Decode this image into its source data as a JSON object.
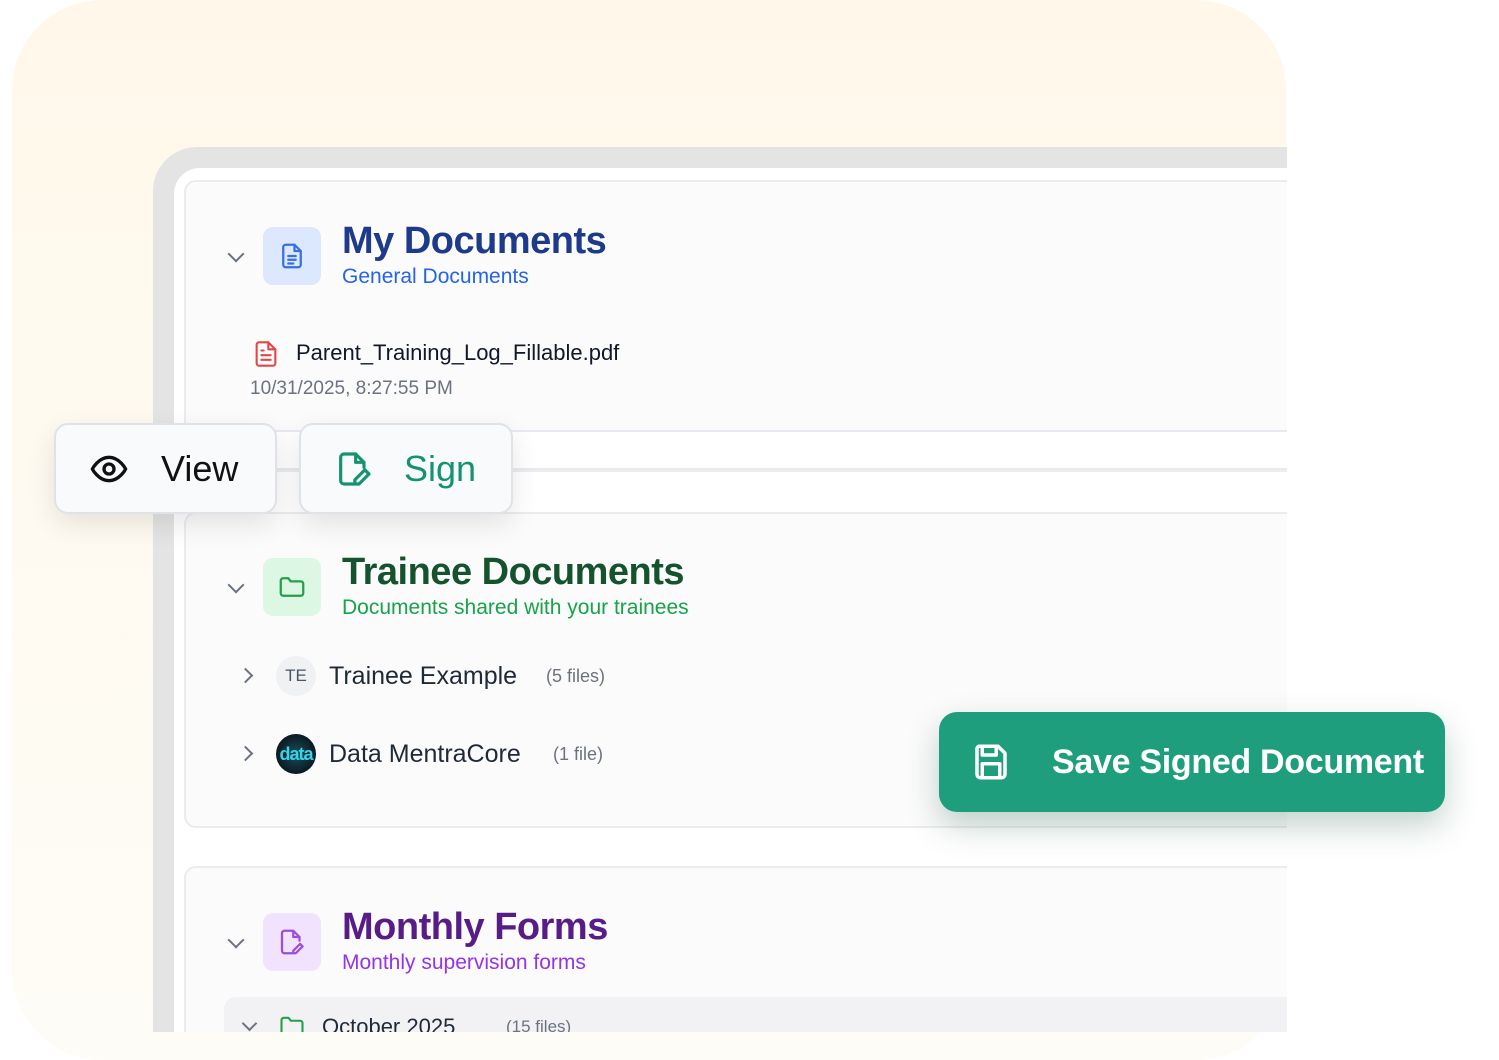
{
  "my_documents": {
    "title": "My Documents",
    "subtitle": "General Documents",
    "icon": "document-icon",
    "color": "#1e3a8a",
    "subtitle_color": "#2563eb",
    "file": {
      "name": "Parent_Training_Log_Fillable.pdf",
      "date": "10/31/2025, 8:27:55 PM",
      "icon": "pdf-file-icon"
    }
  },
  "actions": {
    "view_label": "View",
    "sign_label": "Sign",
    "save_label": "Save Signed Document"
  },
  "trainee_documents": {
    "title": "Trainee Documents",
    "subtitle": "Documents shared with your trainees",
    "icon": "folder-icon",
    "color": "#14532d",
    "subtitle_color": "#16a34a",
    "trainees": [
      {
        "initials": "TE",
        "name": "Trainee Example",
        "count": "(5 files)"
      },
      {
        "initials": "data",
        "name": "Data MentraCore",
        "count": "(1 file)"
      }
    ]
  },
  "monthly_forms": {
    "title": "Monthly Forms",
    "subtitle": "Monthly supervision forms",
    "icon": "edit-document-icon",
    "color": "#581c87",
    "subtitle_color": "#9333ea",
    "months": [
      {
        "name": "October 2025",
        "count": "(15 files)"
      }
    ]
  },
  "colors": {
    "accent_green": "#1f9e7e",
    "sign_green": "#15926f",
    "pdf_red": "#e04848"
  }
}
